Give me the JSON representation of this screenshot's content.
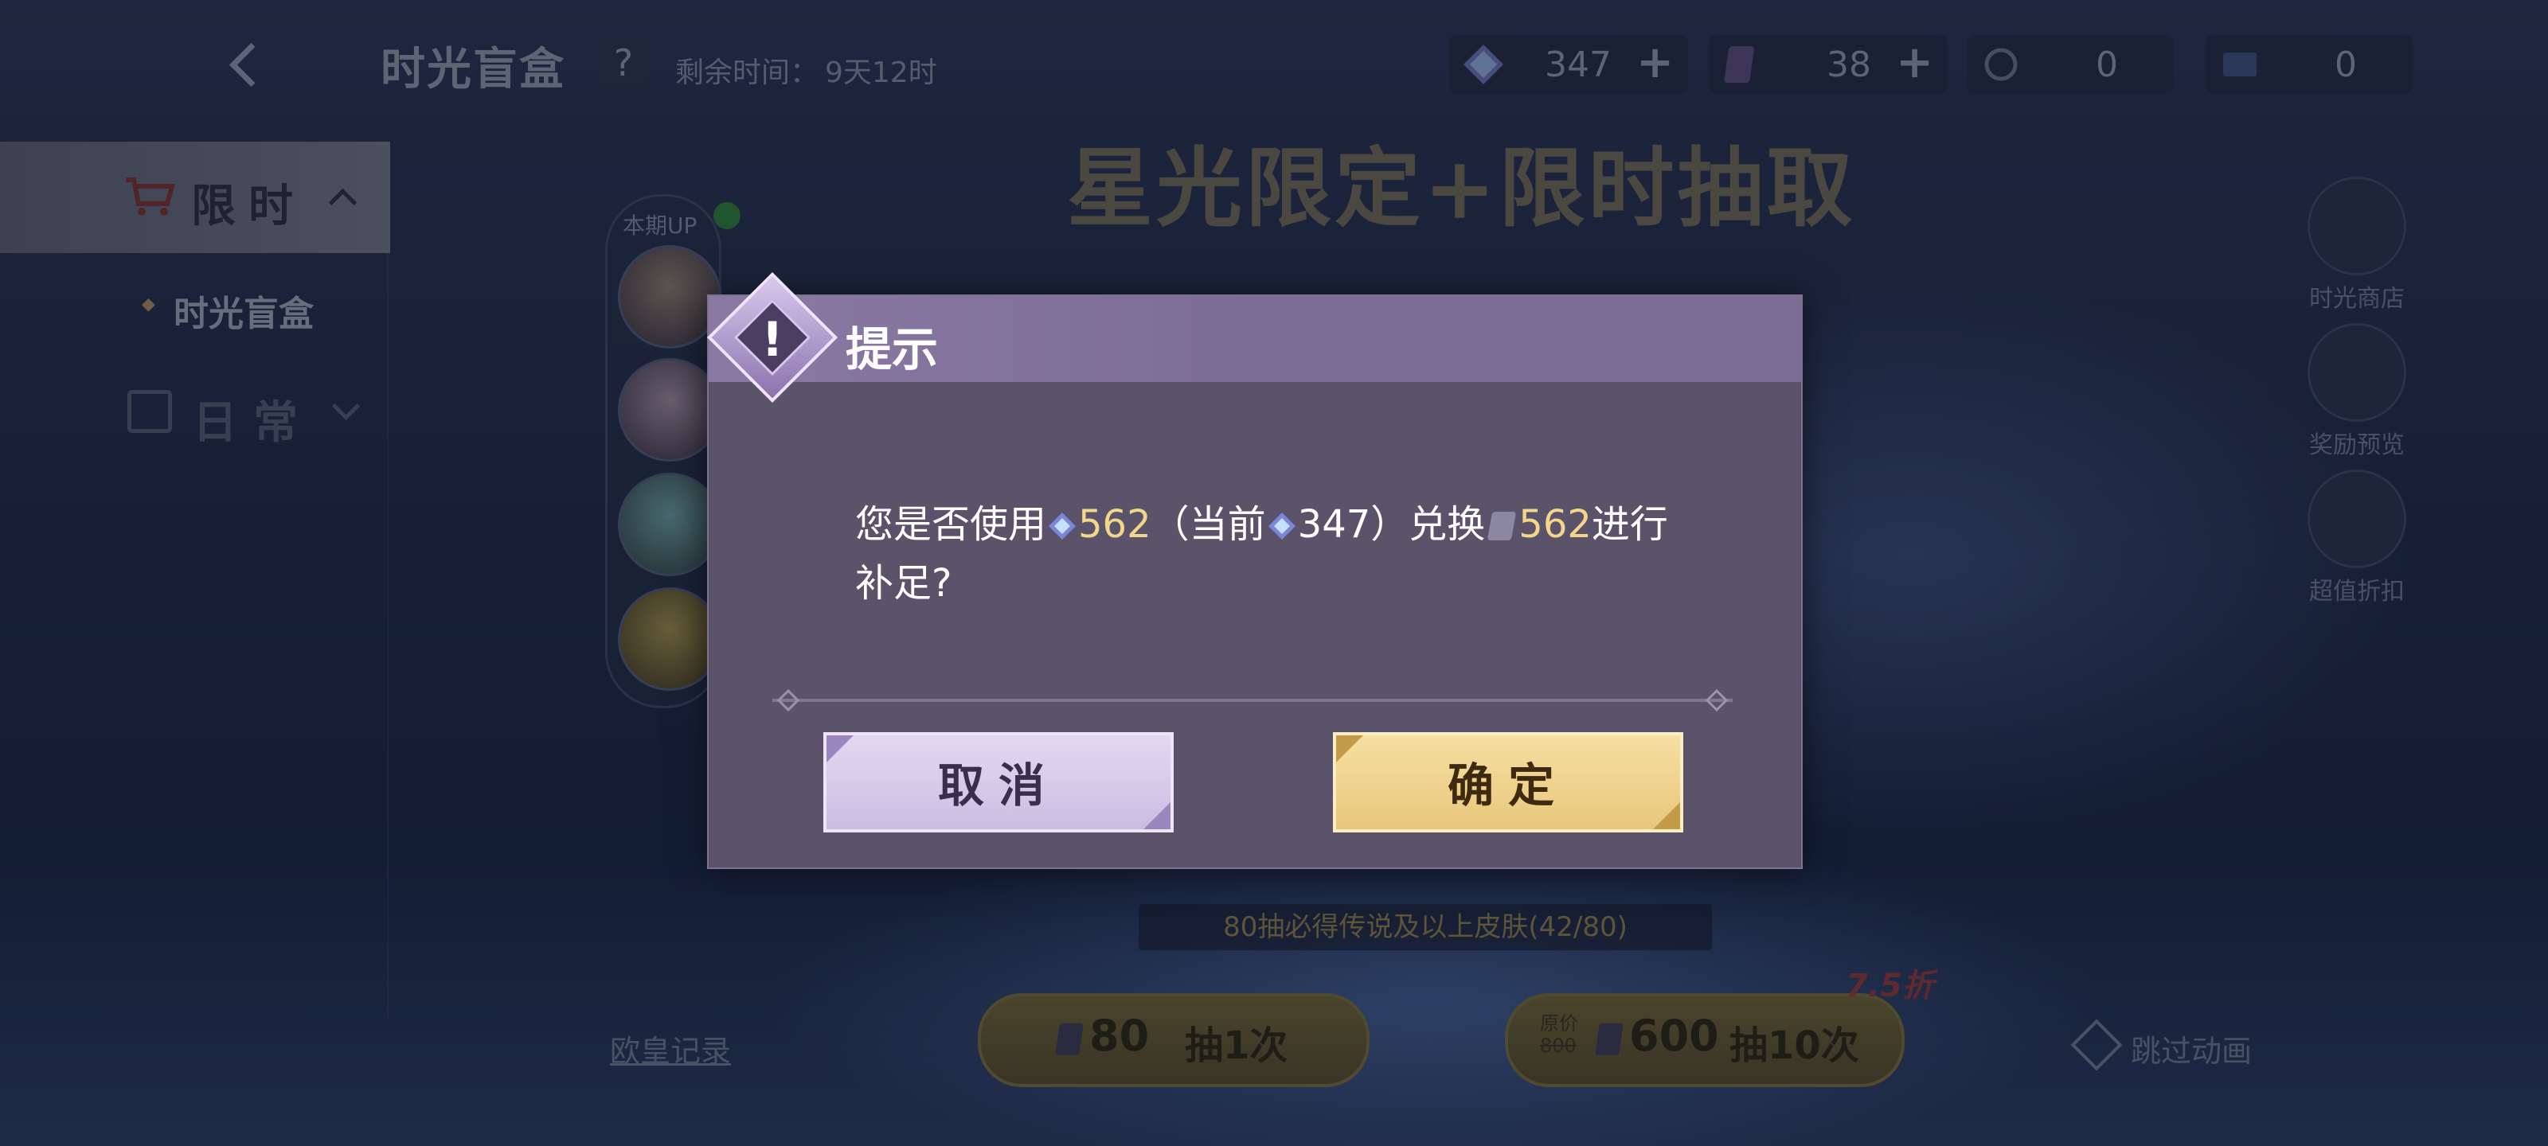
{
  "topbar": {
    "back_icon": "back-arrow-icon",
    "title": "时光盲盒",
    "help_label": "?",
    "time_label": "剩余时间：",
    "time_value": "9天12时",
    "currencies": [
      {
        "icon": "diamond-icon",
        "amount": "347",
        "plus": "+"
      },
      {
        "icon": "card-ticket-icon",
        "amount": "38",
        "plus": "+"
      },
      {
        "icon": "token-icon",
        "amount": "0"
      },
      {
        "icon": "coupon-icon",
        "amount": "0"
      }
    ]
  },
  "sidebar": {
    "limited_label": "限时",
    "limited_sub": "时光盲盒",
    "daily_label": "日常"
  },
  "banner": {
    "title": "星光限定+限时抽取",
    "up_label": "本期UP"
  },
  "side_menu": [
    {
      "icon": "shop-cart-icon",
      "label": "时光商店"
    },
    {
      "icon": "gift-box-icon",
      "label": "奖励预览"
    },
    {
      "icon": "discount-tag-icon",
      "label": "超值折扣"
    }
  ],
  "bottom": {
    "progress_text": "80抽必得传说及以上皮肤(42/80)",
    "lucky_record": "欧皇记录",
    "draw1_cost": "80",
    "draw1_label": "抽1次",
    "draw10_orig_label": "原价",
    "draw10_orig_price": "800",
    "draw10_cost": "600",
    "draw10_label": "抽10次",
    "discount": "7.5折",
    "skip_label": "跳过动画"
  },
  "dialog": {
    "title": "提示",
    "msg_part1": "您是否使用",
    "msg_amount1": "562",
    "msg_part2": "（当前",
    "msg_current": "347",
    "msg_part3": "）兑换",
    "msg_amount2": "562",
    "msg_part4": "进行",
    "msg_line2": "补足?",
    "cancel_label": "取消",
    "confirm_label": "确定"
  }
}
